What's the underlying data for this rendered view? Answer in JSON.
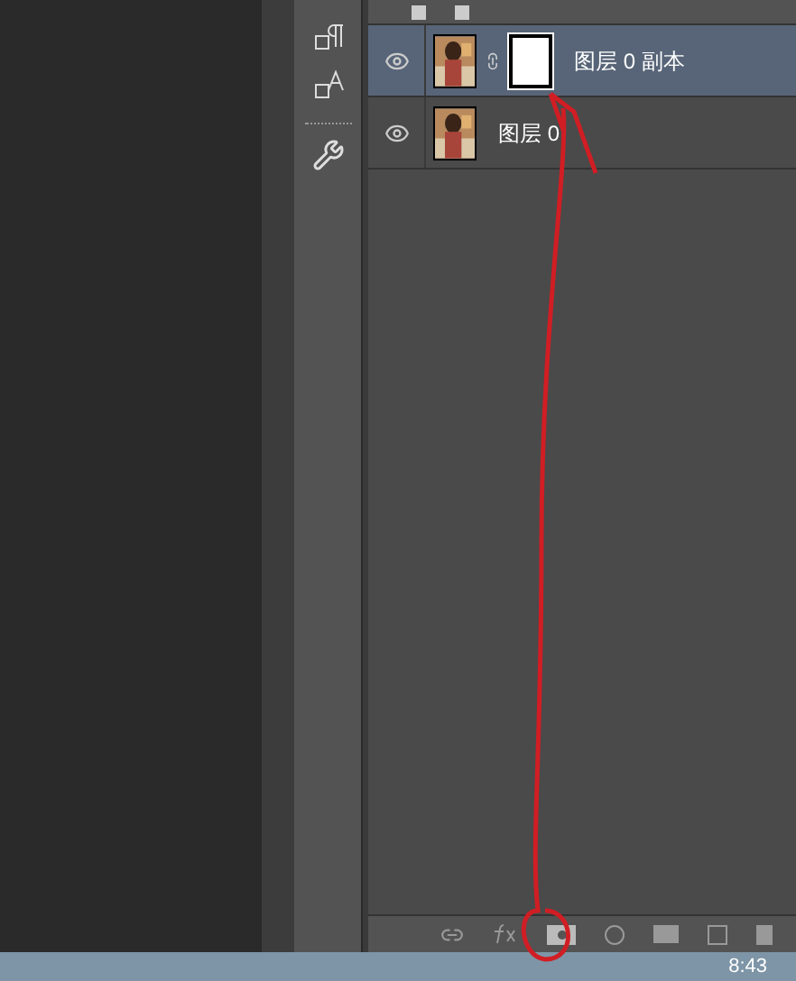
{
  "layers": [
    {
      "name": "图层 0 副本",
      "selected": true,
      "visible": true,
      "has_mask": true
    },
    {
      "name": "图层 0",
      "selected": false,
      "visible": true,
      "has_mask": false
    }
  ],
  "taskbar": {
    "time": "8:43"
  }
}
